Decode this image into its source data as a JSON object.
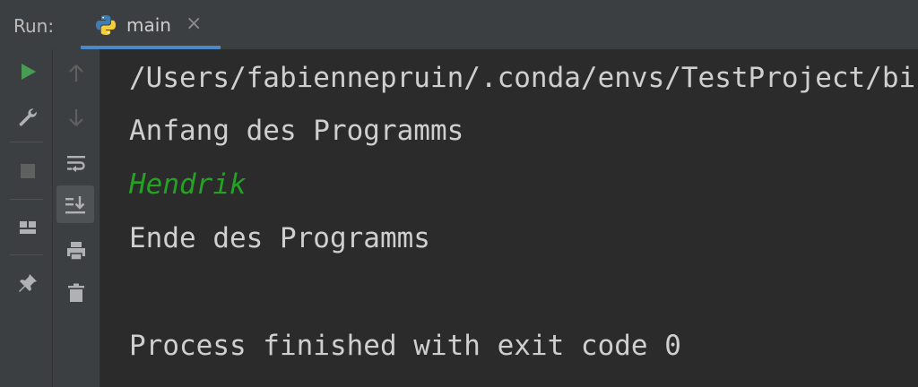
{
  "tool_window": {
    "title": "Run:",
    "tab": {
      "label": "main",
      "icon": "python-icon",
      "close_glyph": "×"
    }
  },
  "toolbar_left": [
    {
      "name": "run-icon",
      "color": "#499c54"
    },
    {
      "name": "wrench-icon"
    },
    {
      "name": "stop-icon"
    },
    {
      "name": "layout-icon"
    },
    {
      "name": "pin-icon"
    }
  ],
  "toolbar_right": [
    {
      "name": "arrow-up-icon"
    },
    {
      "name": "arrow-down-icon"
    },
    {
      "name": "soft-wrap-icon"
    },
    {
      "name": "scroll-to-end-icon"
    },
    {
      "name": "print-icon"
    },
    {
      "name": "trash-icon"
    }
  ],
  "console": {
    "lines": [
      "/Users/fabiennepruin/.conda/envs/TestProject/bin/python",
      "Anfang des Programms",
      "Hendrik",
      "Ende des Programms",
      "",
      "Process finished with exit code 0"
    ],
    "input_line_color": "#23a223"
  }
}
